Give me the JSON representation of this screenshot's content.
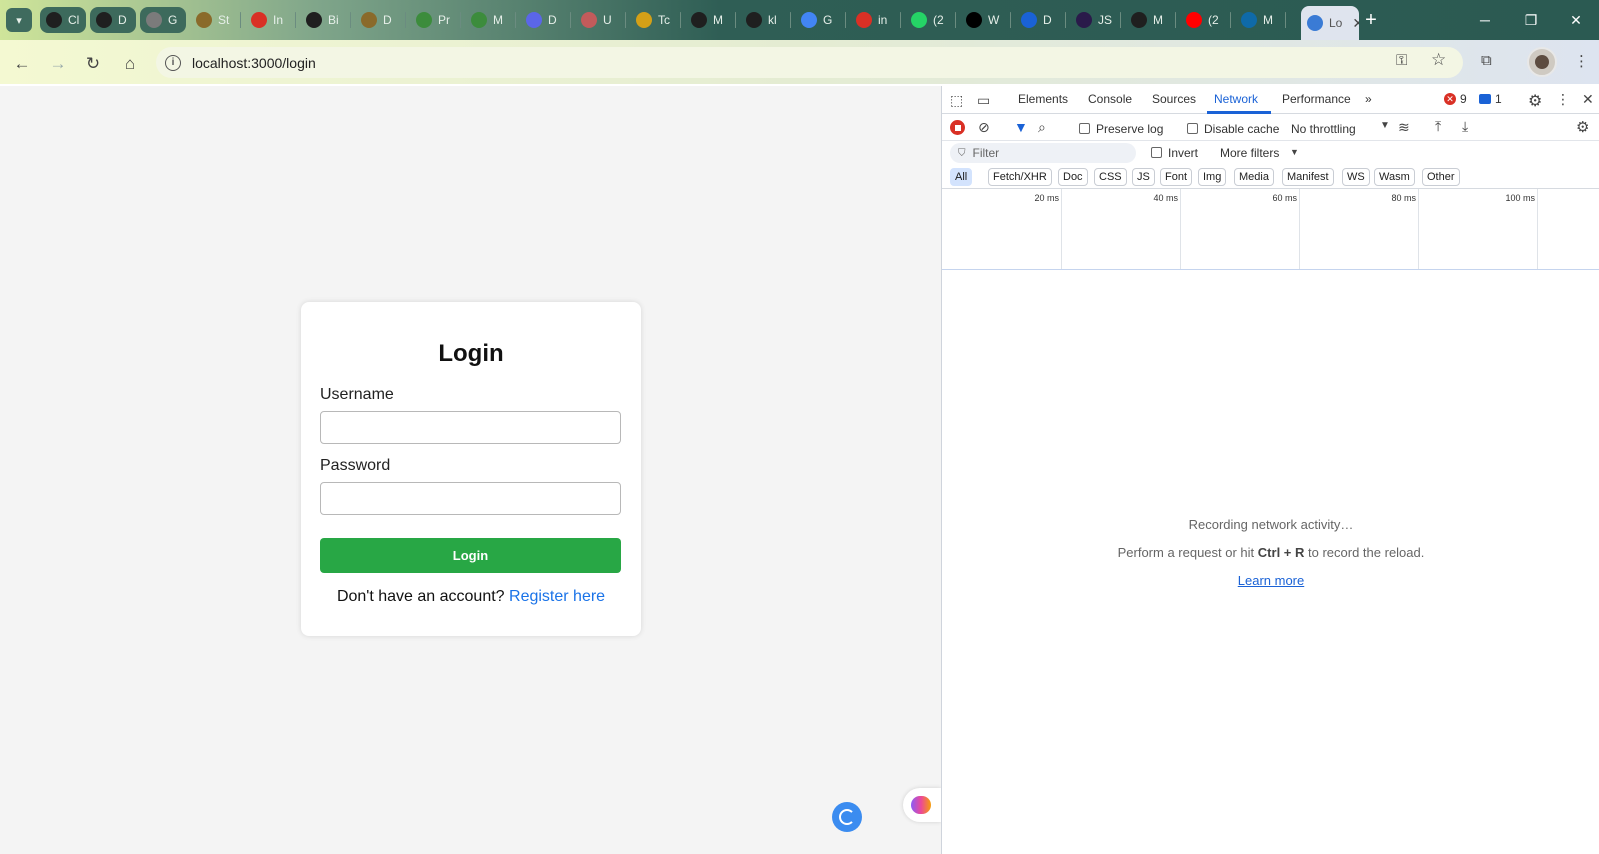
{
  "browser": {
    "tabs": [
      {
        "label": "Cl",
        "icon": "openai-icon",
        "color": "#1f1f1f",
        "pinned": true
      },
      {
        "label": "D",
        "icon": "mongodb-icon",
        "color": "#1f1f1f",
        "pinned": true
      },
      {
        "label": "G",
        "icon": "gitlab-icon",
        "color": "#7b7b7b",
        "pinned": true
      },
      {
        "label": "St",
        "icon": "stack-icon",
        "color": "#8a6a2a"
      },
      {
        "label": "In",
        "icon": "gmail-icon",
        "color": "#d93025"
      },
      {
        "label": "Bi",
        "icon": "info-icon",
        "color": "#1f1f1f"
      },
      {
        "label": "D",
        "icon": "stack-icon",
        "color": "#8a6a2a"
      },
      {
        "label": "Pr",
        "icon": "dots-icon",
        "color": "#3c8c3c"
      },
      {
        "label": "M",
        "icon": "dots-icon",
        "color": "#3c8c3c"
      },
      {
        "label": "D",
        "icon": "vite-icon",
        "color": "#5b66e8"
      },
      {
        "label": "U",
        "icon": "person-icon",
        "color": "#c25b5b"
      },
      {
        "label": "Tc",
        "icon": "candle-icon",
        "color": "#d4a017"
      },
      {
        "label": "M",
        "icon": "github-icon",
        "color": "#1f1f1f"
      },
      {
        "label": "kl",
        "icon": "github-icon",
        "color": "#1f1f1f"
      },
      {
        "label": "G",
        "icon": "google-icon",
        "color": "#4285f4"
      },
      {
        "label": "in",
        "icon": "gmail-icon",
        "color": "#d93025"
      },
      {
        "label": "(2",
        "icon": "whatsapp-icon",
        "color": "#25d366"
      },
      {
        "label": "W",
        "icon": "medium-icon",
        "color": "#000000"
      },
      {
        "label": "D",
        "icon": "download-icon",
        "color": "#1a62d6"
      },
      {
        "label": "JS",
        "icon": "js-icon",
        "color": "#2a1a4a"
      },
      {
        "label": "M",
        "icon": "github-icon",
        "color": "#1f1f1f"
      },
      {
        "label": "(2",
        "icon": "youtube-icon",
        "color": "#ff0000"
      },
      {
        "label": "M",
        "icon": "mysql-icon",
        "color": "#0f6aa8"
      }
    ],
    "active_tab": {
      "label": "Lo",
      "close": "✕"
    },
    "new_tab": "+",
    "window": {
      "minimize": "─",
      "restore": "❐",
      "close": "✕"
    },
    "address": {
      "url": "localhost:3000/login"
    }
  },
  "login": {
    "title": "Login",
    "username_label": "Username",
    "username_value": "",
    "password_label": "Password",
    "password_value": "",
    "submit_label": "Login",
    "register_prompt": "Don't have an account?",
    "register_link": "Register here"
  },
  "devtools": {
    "tabs": [
      "Elements",
      "Console",
      "Sources",
      "Network",
      "Performance"
    ],
    "active_tab": "Network",
    "more_tabs": "»",
    "errors": "9",
    "messages": "1",
    "preserve_log": "Preserve log",
    "disable_cache": "Disable cache",
    "throttling": "No throttling",
    "filter_placeholder": "Filter",
    "invert": "Invert",
    "more_filters": "More filters",
    "type_filters": [
      "All",
      "Fetch/XHR",
      "Doc",
      "CSS",
      "JS",
      "Font",
      "Img",
      "Media",
      "Manifest",
      "WS",
      "Wasm",
      "Other"
    ],
    "timeline_ticks": [
      "20 ms",
      "40 ms",
      "60 ms",
      "80 ms",
      "100 ms"
    ],
    "empty": {
      "recording": "Recording network activity…",
      "hint_prefix": "Perform a request or hit",
      "hint_key": "Ctrl + R",
      "hint_suffix": "to record the reload.",
      "learn_more": "Learn more"
    }
  }
}
